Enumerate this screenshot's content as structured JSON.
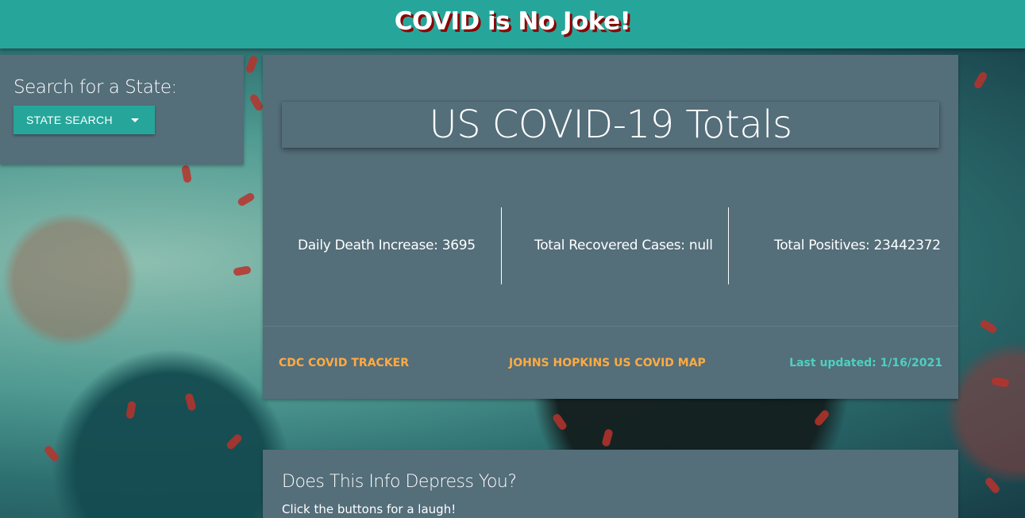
{
  "header": {
    "title": "COVID is No Joke!"
  },
  "search": {
    "title": "Search for a State:",
    "button_label": "STATE SEARCH",
    "caret_icon": "caret-down-icon"
  },
  "totals": {
    "title": "US COVID-19 Totals",
    "stats": [
      {
        "label": "Daily Death Increase: 3695"
      },
      {
        "label": "Total Recovered Cases: null"
      },
      {
        "label": "Total Positives: 23442372"
      }
    ],
    "links": {
      "cdc": "CDC COVID TRACKER",
      "jhu": "JOHNS HOPKINS US COVID MAP"
    },
    "last_updated": "Last updated: 1/16/2021"
  },
  "joke": {
    "title": "Does This Info Depress You?",
    "subtitle": "Click the buttons for a laugh!"
  },
  "colors": {
    "header_bg": "#26a69a",
    "panel_bg": "#546e7a",
    "link_orange": "#ffab40",
    "updated_teal": "#4dd0c1",
    "title_shadow": "#8b0000"
  }
}
